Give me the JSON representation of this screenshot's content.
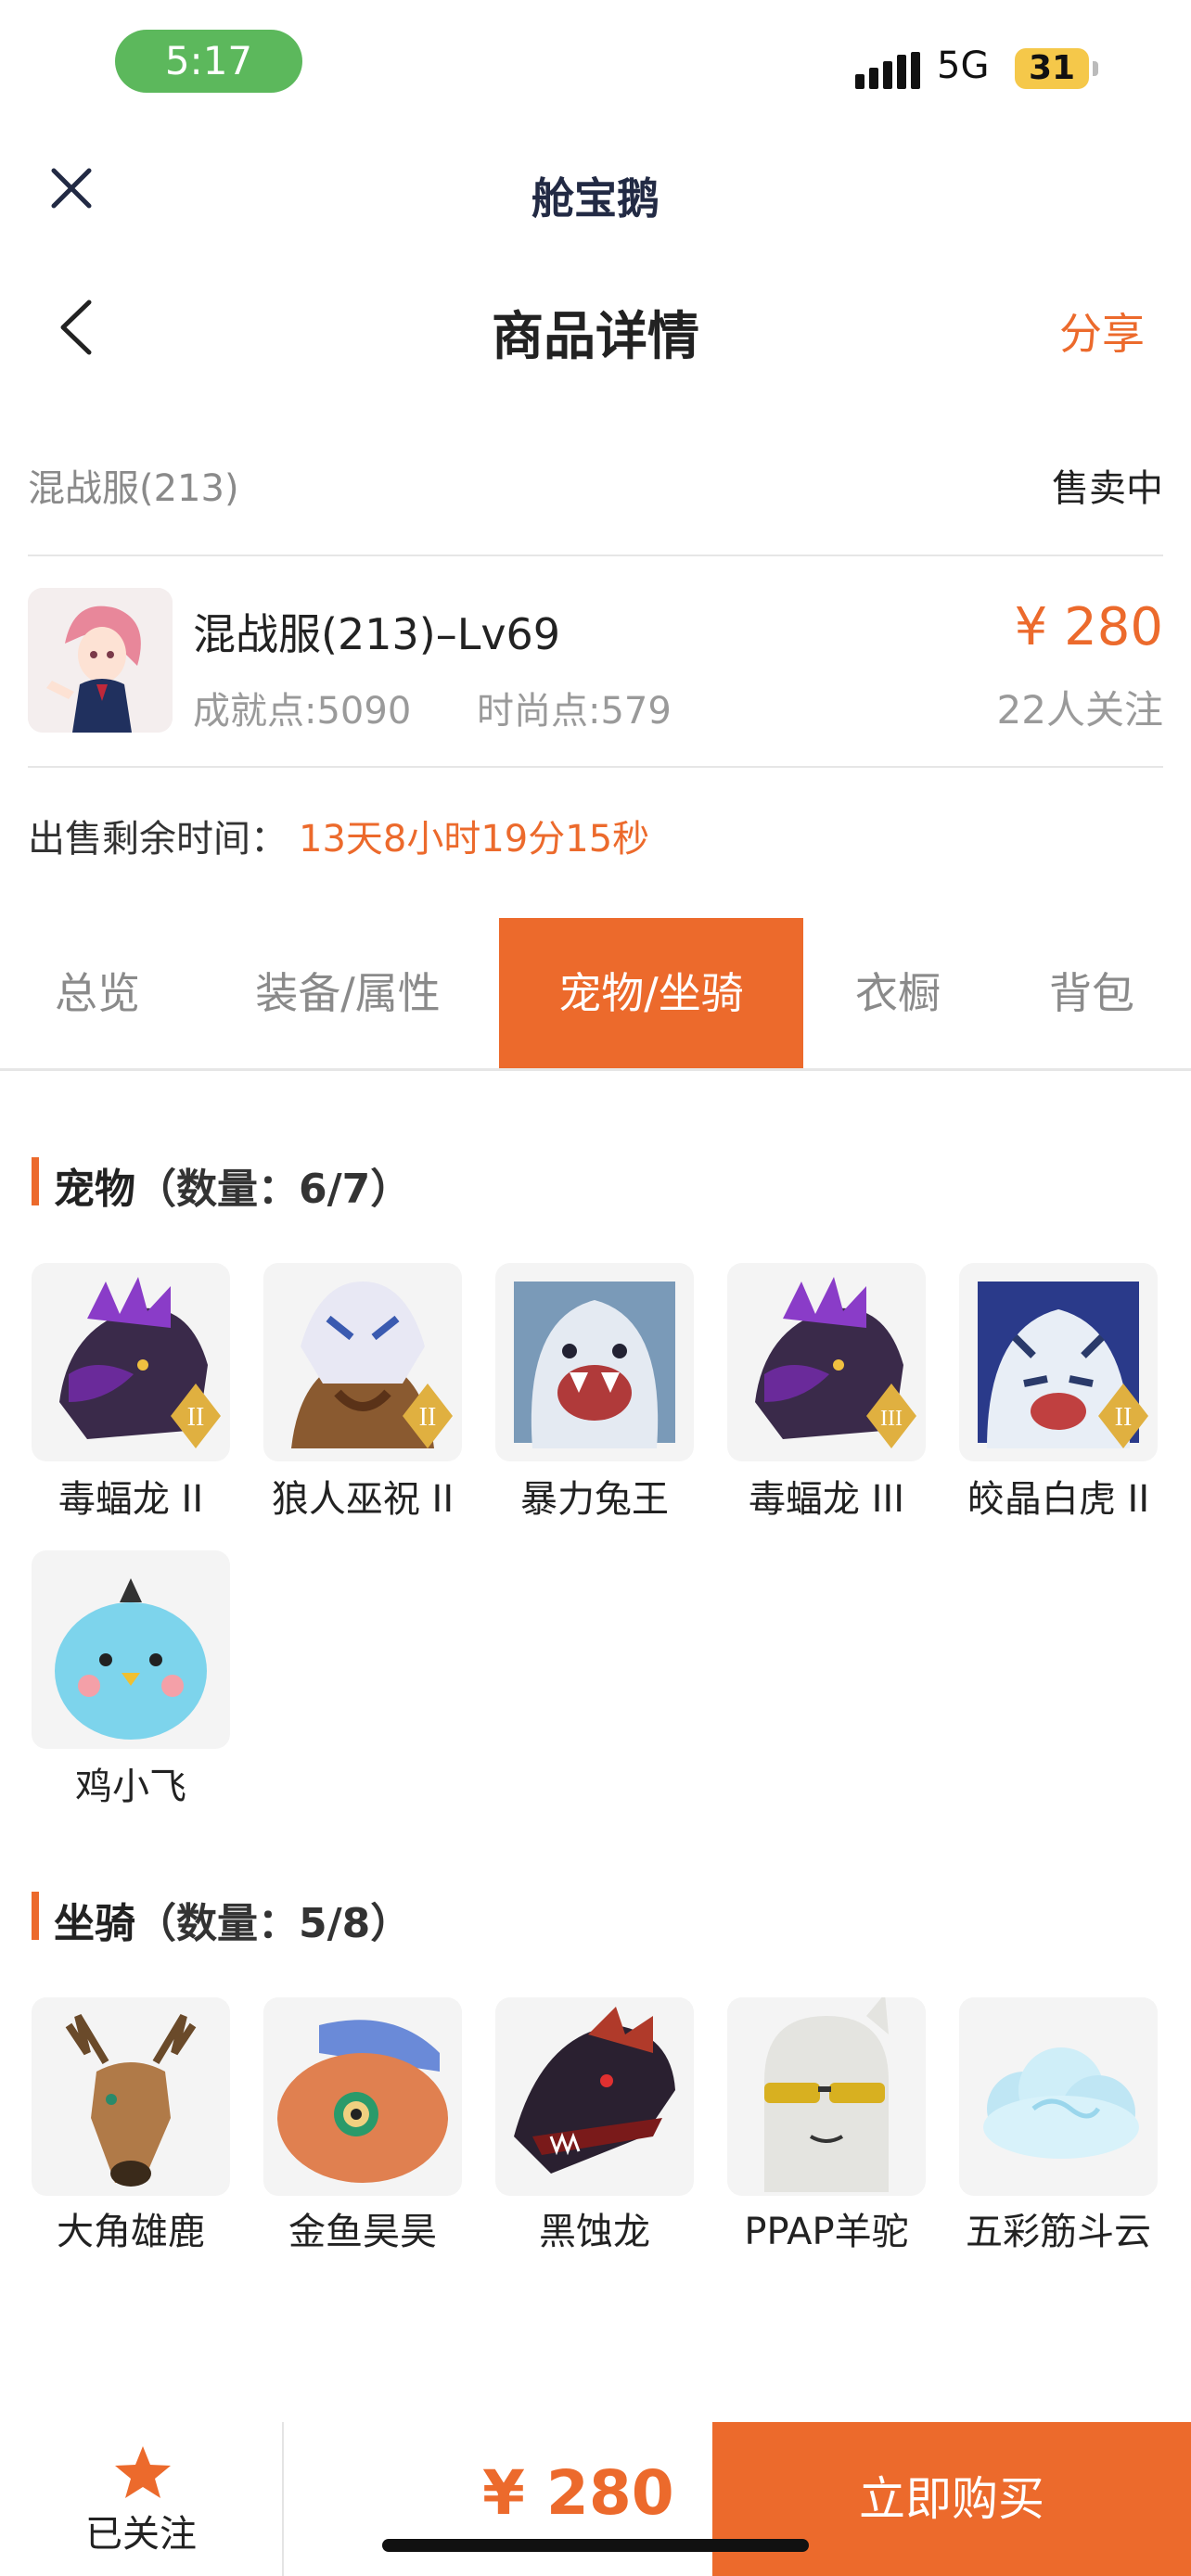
{
  "status_bar": {
    "time": "5:17",
    "network": "5G",
    "battery": "31"
  },
  "nav": {
    "app_title": "舱宝鹅",
    "page_title": "商品详情",
    "share_label": "分享"
  },
  "server_line": {
    "server": "混战服(213)",
    "status": "售卖中"
  },
  "product": {
    "name": "混战服(213)–Lv69",
    "achievement": "成就点:5090",
    "fashion": "时尚点:579",
    "price": "¥ 280",
    "followers": "22人关注"
  },
  "remaining": {
    "label": "出售剩余时间：",
    "value": "13天8小时19分15秒"
  },
  "tabs": [
    {
      "label": "总览",
      "active": false
    },
    {
      "label": "装备/属性",
      "active": false
    },
    {
      "label": "宠物/坐骑",
      "active": true
    },
    {
      "label": "衣橱",
      "active": false
    },
    {
      "label": "背包",
      "active": false
    }
  ],
  "pets": {
    "title": "宠物",
    "count": "（数量：6/7）",
    "items": [
      {
        "label": "毒蝠龙 II",
        "icon": "purple-dragon",
        "badge": "II"
      },
      {
        "label": "狼人巫祝 II",
        "icon": "werewolf-shaman",
        "badge": "II"
      },
      {
        "label": "暴力兔王",
        "icon": "rabbit-king",
        "badge": ""
      },
      {
        "label": "毒蝠龙 III",
        "icon": "purple-dragon",
        "badge": "III"
      },
      {
        "label": "皎晶白虎 II",
        "icon": "white-tiger",
        "badge": "II"
      },
      {
        "label": "鸡小飞",
        "icon": "blue-chick",
        "badge": ""
      }
    ]
  },
  "mounts": {
    "title": "坐骑",
    "count": "（数量：5/8）",
    "items": [
      {
        "label": "大角雄鹿",
        "icon": "stag"
      },
      {
        "label": "金鱼昊昊",
        "icon": "goldfish"
      },
      {
        "label": "黑蚀龙",
        "icon": "black-dragon"
      },
      {
        "label": "PPAP羊驼",
        "icon": "alpaca"
      },
      {
        "label": "五彩筋斗云",
        "icon": "cloud"
      }
    ]
  },
  "bottom_bar": {
    "follow_label": "已关注",
    "price": "¥ 280",
    "buy_label": "立即购买"
  },
  "colors": {
    "accent": "#ec6a2c",
    "status_green": "#5cb85c"
  }
}
